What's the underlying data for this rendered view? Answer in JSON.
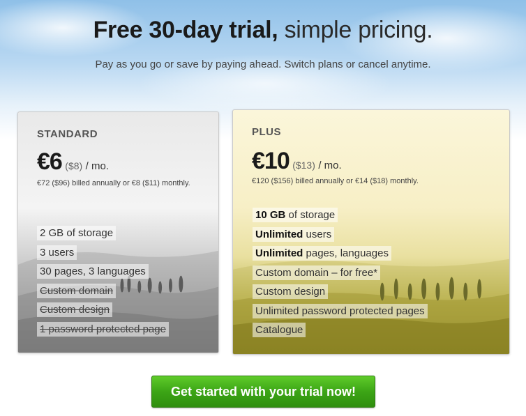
{
  "header": {
    "title_bold": "Free 30-day trial,",
    "title_light": "simple pricing.",
    "subtitle": "Pay as you go or save by paying ahead. Switch plans or cancel anytime."
  },
  "plans": [
    {
      "name": "STANDARD",
      "price": "€6",
      "price_usd": "($8)",
      "period": "/ mo.",
      "billing": "€72 ($96) billed annually or €8 ($11) monthly.",
      "features": [
        {
          "text": "2 GB of storage"
        },
        {
          "text": "3 users"
        },
        {
          "text": "30 pages, 3 languages"
        },
        {
          "text": "Custom domain"
        },
        {
          "text": "Custom design"
        },
        {
          "text": "1 password protected page"
        }
      ]
    },
    {
      "name": "PLUS",
      "price": "€10",
      "price_usd": "($13)",
      "period": "/ mo.",
      "billing": "€120 ($156) billed annually or €14 ($18) monthly.",
      "features": [
        {
          "bold": "10 GB",
          "text": "of storage"
        },
        {
          "bold": "Unlimited",
          "text": "users"
        },
        {
          "bold": "Unlimited",
          "text": "pages, languages"
        },
        {
          "text": "Custom domain – for free*"
        },
        {
          "text": "Custom design"
        },
        {
          "text": "Unlimited password protected pages"
        },
        {
          "text": "Catalogue"
        }
      ]
    }
  ],
  "cta": {
    "label": "Get started with your trial now!"
  },
  "colors": {
    "cta_green": "#3ca516",
    "standard_bg": "#bdbdbd",
    "plus_bg": "#e9e0a0"
  }
}
